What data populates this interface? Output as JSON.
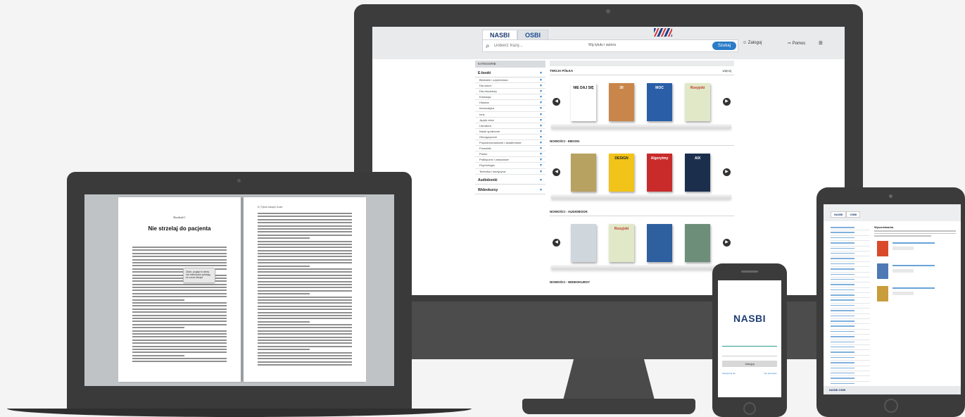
{
  "monitor": {
    "tabs": [
      "NASBI",
      "OSBI"
    ],
    "search_placeholder": "Dobierz frazę...",
    "search_scope": "Wg tytułu i autora",
    "search_button": "Szukaj",
    "login": "Zaloguj",
    "help": "Pomoc",
    "categories_header": "KATEGORIE",
    "category_group_ebooks": "E-booki",
    "categories": [
      "Biblioteki i czytelnictwo",
      "Dla dzieci",
      "Dla młodzieży",
      "Edukacja",
      "Historia",
      "Informatyka",
      "Inne",
      "Języki obce",
      "Literatura",
      "Nauki społeczne",
      "Obcojęzyczne",
      "Popularnonaukowe i akademickie",
      "Poradniki",
      "Prawo",
      "Praktyczne i zawodowe",
      "Psychologia",
      "Technika i medycyna"
    ],
    "category_group_audiobooks": "Audiobooki",
    "category_group_videos": "Wideokursy",
    "sections": [
      {
        "label": "TWOJA PÓŁKA",
        "more": "więcej"
      },
      {
        "label": "NOWOŚCI - EBOOK",
        "more": ""
      },
      {
        "label": "NOWOŚCI - AUDIOBOOK",
        "more": ""
      }
    ],
    "bottom_section": "NOWOŚCI - WIDEOKURSY",
    "book_titles": [
      "NIE DAJ SIĘ",
      "30",
      "MOC",
      "Rosyjski",
      "",
      "DESIGN",
      "Algorytmy",
      "AIX",
      "",
      "Rosyjski",
      "",
      ""
    ]
  },
  "ereader": {
    "chapter": "Rozdział 1",
    "title": "Nie strzelaj do pacjenta",
    "note": "Zdań, pogląd w kiedy nie dokonywa opisbyg, że coraz kiedyś",
    "running_head": "8   |   Tytułu książki, Autor"
  },
  "phone": {
    "logo": "NASBI",
    "login_button": "Zaloguj",
    "link_left": "Zarejestruj się",
    "link_right": "Nie pamiętam"
  },
  "tablet": {
    "tabs": [
      "NASBI",
      "OSBI"
    ],
    "heading": "Wyszukiwarka",
    "footer": "NASBI  OSBI"
  },
  "colors": {
    "brand_navy": "#1f3d73",
    "accent_blue": "#2a7cc7",
    "device_frame": "#3c3c3d",
    "accent_red": "#d63636"
  }
}
